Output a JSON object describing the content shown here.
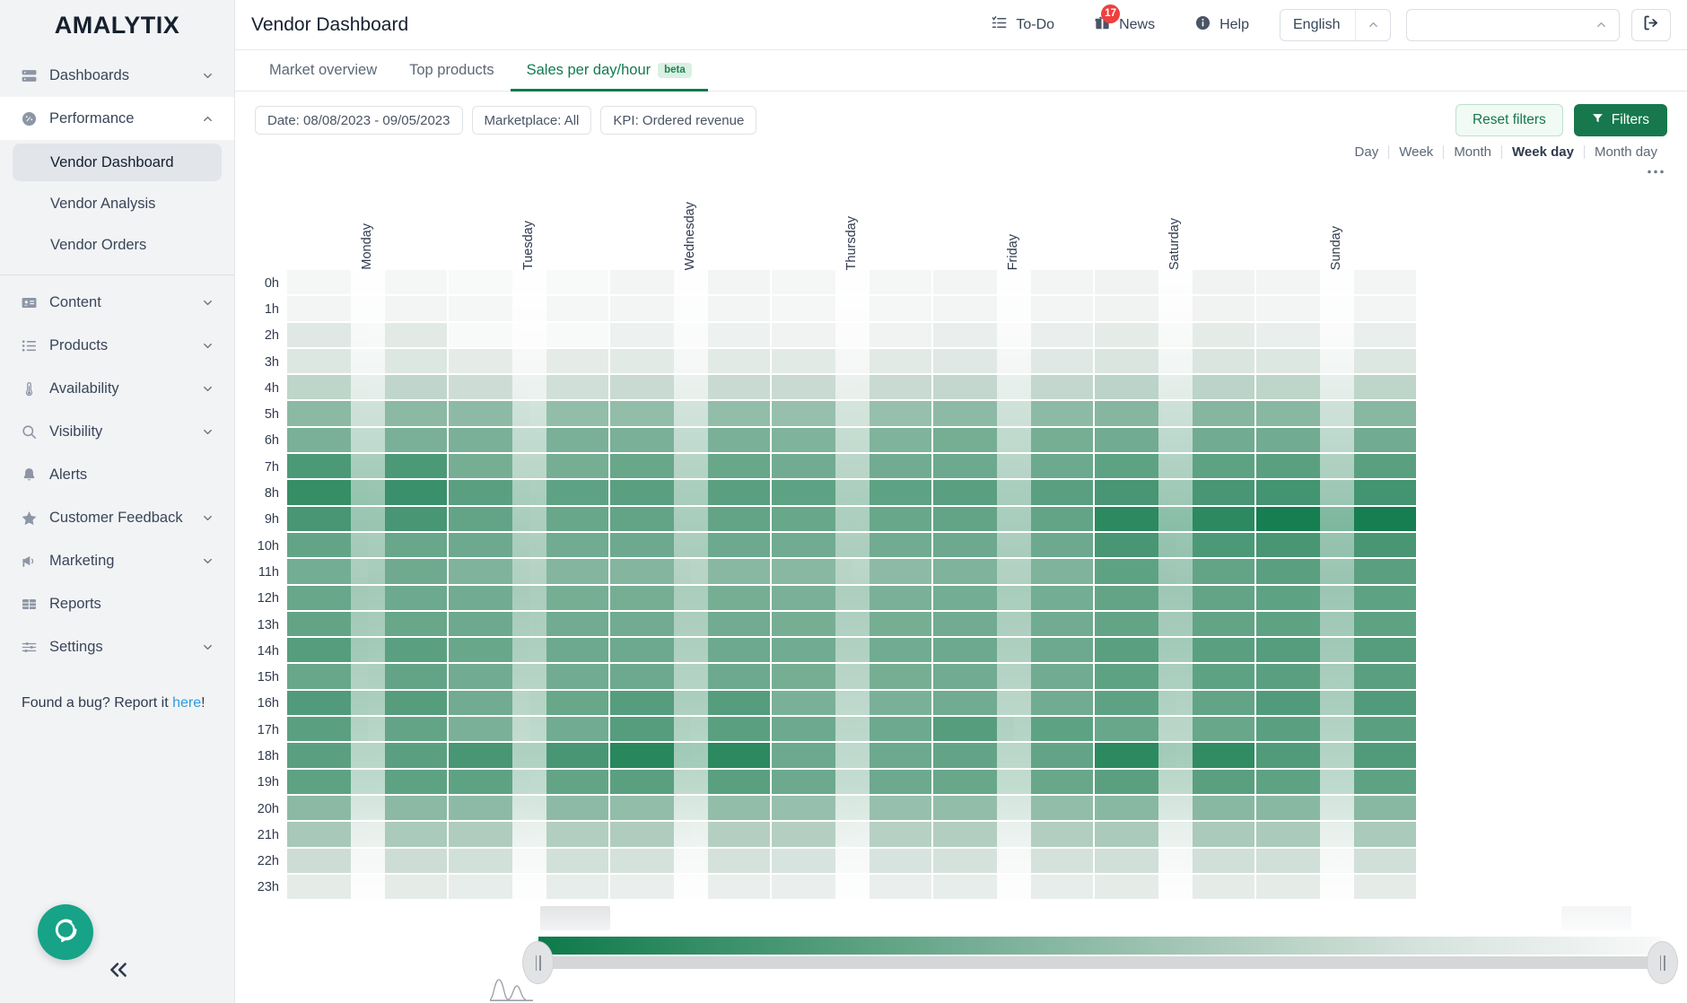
{
  "brand": "AMALYTIX",
  "sidebar": {
    "items": [
      {
        "label": "Dashboards",
        "icon": "dashboards-icon",
        "expandable": true
      },
      {
        "label": "Performance",
        "icon": "performance-icon",
        "expandable": true,
        "expanded": true
      },
      {
        "label": "Content",
        "icon": "content-icon",
        "expandable": true
      },
      {
        "label": "Products",
        "icon": "products-icon",
        "expandable": true
      },
      {
        "label": "Availability",
        "icon": "availability-icon",
        "expandable": true
      },
      {
        "label": "Visibility",
        "icon": "visibility-icon",
        "expandable": true
      },
      {
        "label": "Alerts",
        "icon": "alerts-icon",
        "expandable": false
      },
      {
        "label": "Customer Feedback",
        "icon": "customer-feedback-icon",
        "expandable": true
      },
      {
        "label": "Marketing",
        "icon": "marketing-icon",
        "expandable": true
      },
      {
        "label": "Reports",
        "icon": "reports-icon",
        "expandable": false
      },
      {
        "label": "Settings",
        "icon": "settings-icon",
        "expandable": true
      }
    ],
    "sub_items": [
      {
        "label": "Vendor Dashboard",
        "selected": true
      },
      {
        "label": "Vendor Analysis",
        "selected": false
      },
      {
        "label": "Vendor Orders",
        "selected": false
      }
    ],
    "bug_text_before": "Found a bug? Report it ",
    "bug_link": "here",
    "bug_text_after": "!"
  },
  "header": {
    "title": "Vendor Dashboard",
    "todo_label": "To-Do",
    "news_label": "News",
    "news_badge": "17",
    "help_label": "Help",
    "language_value": "English",
    "account_value": "",
    "account_placeholder": ""
  },
  "tabs": [
    {
      "label": "Market overview",
      "active": false,
      "badge": null
    },
    {
      "label": "Top products",
      "active": false,
      "badge": null
    },
    {
      "label": "Sales per day/hour",
      "active": true,
      "badge": "beta"
    }
  ],
  "filters": {
    "chips": [
      "Date: 08/08/2023 - 09/05/2023",
      "Marketplace: All",
      "KPI: Ordered revenue"
    ],
    "reset_label": "Reset filters",
    "filters_label": "Filters"
  },
  "granularity": {
    "options": [
      "Day",
      "Week",
      "Month",
      "Week day",
      "Month day"
    ],
    "selected": "Week day"
  },
  "chart_data": {
    "type": "heatmap",
    "title": "Sales per day/hour",
    "xlabel": "",
    "ylabel": "",
    "colorscale": {
      "low": "#ffffff",
      "high": "#0d7a4a",
      "name": "white-to-green"
    },
    "value_unit": "Ordered revenue",
    "categories": [
      "Monday",
      "Tuesday",
      "Wednesday",
      "Thursday",
      "Friday",
      "Saturday",
      "Sunday"
    ],
    "subcolumns_per_category": 2,
    "hours": [
      "0h",
      "1h",
      "2h",
      "3h",
      "4h",
      "5h",
      "6h",
      "7h",
      "8h",
      "9h",
      "10h",
      "11h",
      "12h",
      "13h",
      "14h",
      "15h",
      "16h",
      "17h",
      "18h",
      "19h",
      "20h",
      "21h",
      "22h",
      "23h"
    ],
    "intensity_max": 1.0,
    "series": [
      {
        "name": "Monday",
        "values": [
          [
            0.03,
            0.03
          ],
          [
            0.04,
            0.04
          ],
          [
            0.11,
            0.1
          ],
          [
            0.12,
            0.12
          ],
          [
            0.24,
            0.23
          ],
          [
            0.45,
            0.45
          ],
          [
            0.52,
            0.52
          ],
          [
            0.72,
            0.72
          ],
          [
            0.82,
            0.8
          ],
          [
            0.74,
            0.74
          ],
          [
            0.62,
            0.6
          ],
          [
            0.55,
            0.57
          ],
          [
            0.6,
            0.58
          ],
          [
            0.62,
            0.6
          ],
          [
            0.68,
            0.66
          ],
          [
            0.6,
            0.62
          ],
          [
            0.7,
            0.68
          ],
          [
            0.66,
            0.62
          ],
          [
            0.66,
            0.66
          ],
          [
            0.64,
            0.64
          ],
          [
            0.45,
            0.45
          ],
          [
            0.33,
            0.32
          ],
          [
            0.18,
            0.18
          ],
          [
            0.09,
            0.09
          ]
        ]
      },
      {
        "name": "Tuesday",
        "values": [
          [
            0.02,
            0.02
          ],
          [
            0.03,
            0.03
          ],
          [
            0.02,
            0.02
          ],
          [
            0.09,
            0.09
          ],
          [
            0.18,
            0.17
          ],
          [
            0.44,
            0.42
          ],
          [
            0.52,
            0.52
          ],
          [
            0.54,
            0.54
          ],
          [
            0.66,
            0.64
          ],
          [
            0.62,
            0.6
          ],
          [
            0.58,
            0.56
          ],
          [
            0.5,
            0.48
          ],
          [
            0.56,
            0.54
          ],
          [
            0.58,
            0.56
          ],
          [
            0.6,
            0.58
          ],
          [
            0.56,
            0.56
          ],
          [
            0.56,
            0.6
          ],
          [
            0.52,
            0.56
          ],
          [
            0.74,
            0.74
          ],
          [
            0.64,
            0.62
          ],
          [
            0.44,
            0.44
          ],
          [
            0.3,
            0.29
          ],
          [
            0.16,
            0.16
          ],
          [
            0.08,
            0.08
          ]
        ]
      },
      {
        "name": "Wednesday",
        "values": [
          [
            0.04,
            0.04
          ],
          [
            0.04,
            0.04
          ],
          [
            0.06,
            0.06
          ],
          [
            0.1,
            0.1
          ],
          [
            0.2,
            0.2
          ],
          [
            0.42,
            0.42
          ],
          [
            0.52,
            0.52
          ],
          [
            0.6,
            0.6
          ],
          [
            0.66,
            0.66
          ],
          [
            0.62,
            0.62
          ],
          [
            0.58,
            0.58
          ],
          [
            0.48,
            0.46
          ],
          [
            0.54,
            0.54
          ],
          [
            0.56,
            0.56
          ],
          [
            0.58,
            0.58
          ],
          [
            0.58,
            0.58
          ],
          [
            0.68,
            0.68
          ],
          [
            0.68,
            0.66
          ],
          [
            0.88,
            0.86
          ],
          [
            0.66,
            0.66
          ],
          [
            0.42,
            0.42
          ],
          [
            0.3,
            0.28
          ],
          [
            0.15,
            0.15
          ],
          [
            0.07,
            0.07
          ]
        ]
      },
      {
        "name": "Thursday",
        "values": [
          [
            0.03,
            0.03
          ],
          [
            0.03,
            0.03
          ],
          [
            0.05,
            0.05
          ],
          [
            0.1,
            0.1
          ],
          [
            0.2,
            0.2
          ],
          [
            0.4,
            0.4
          ],
          [
            0.5,
            0.5
          ],
          [
            0.56,
            0.56
          ],
          [
            0.64,
            0.64
          ],
          [
            0.6,
            0.6
          ],
          [
            0.56,
            0.56
          ],
          [
            0.46,
            0.44
          ],
          [
            0.52,
            0.52
          ],
          [
            0.54,
            0.54
          ],
          [
            0.56,
            0.56
          ],
          [
            0.54,
            0.54
          ],
          [
            0.52,
            0.52
          ],
          [
            0.58,
            0.58
          ],
          [
            0.58,
            0.58
          ],
          [
            0.58,
            0.58
          ],
          [
            0.4,
            0.4
          ],
          [
            0.28,
            0.27
          ],
          [
            0.14,
            0.14
          ],
          [
            0.07,
            0.07
          ]
        ]
      },
      {
        "name": "Friday",
        "values": [
          [
            0.04,
            0.04
          ],
          [
            0.04,
            0.04
          ],
          [
            0.07,
            0.07
          ],
          [
            0.11,
            0.11
          ],
          [
            0.22,
            0.22
          ],
          [
            0.44,
            0.44
          ],
          [
            0.54,
            0.54
          ],
          [
            0.58,
            0.58
          ],
          [
            0.66,
            0.66
          ],
          [
            0.62,
            0.62
          ],
          [
            0.58,
            0.58
          ],
          [
            0.5,
            0.5
          ],
          [
            0.55,
            0.55
          ],
          [
            0.56,
            0.56
          ],
          [
            0.58,
            0.58
          ],
          [
            0.56,
            0.56
          ],
          [
            0.56,
            0.56
          ],
          [
            0.68,
            0.64
          ],
          [
            0.62,
            0.62
          ],
          [
            0.6,
            0.6
          ],
          [
            0.42,
            0.42
          ],
          [
            0.29,
            0.29
          ],
          [
            0.15,
            0.15
          ],
          [
            0.08,
            0.08
          ]
        ]
      },
      {
        "name": "Saturday",
        "values": [
          [
            0.05,
            0.05
          ],
          [
            0.05,
            0.05
          ],
          [
            0.09,
            0.09
          ],
          [
            0.13,
            0.13
          ],
          [
            0.25,
            0.25
          ],
          [
            0.47,
            0.47
          ],
          [
            0.56,
            0.56
          ],
          [
            0.64,
            0.64
          ],
          [
            0.74,
            0.74
          ],
          [
            0.86,
            0.86
          ],
          [
            0.74,
            0.72
          ],
          [
            0.64,
            0.62
          ],
          [
            0.62,
            0.62
          ],
          [
            0.62,
            0.62
          ],
          [
            0.66,
            0.66
          ],
          [
            0.64,
            0.64
          ],
          [
            0.64,
            0.62
          ],
          [
            0.6,
            0.6
          ],
          [
            0.86,
            0.84
          ],
          [
            0.66,
            0.66
          ],
          [
            0.46,
            0.46
          ],
          [
            0.32,
            0.32
          ],
          [
            0.17,
            0.17
          ],
          [
            0.09,
            0.09
          ]
        ]
      },
      {
        "name": "Sunday",
        "values": [
          [
            0.04,
            0.04
          ],
          [
            0.04,
            0.04
          ],
          [
            0.07,
            0.07
          ],
          [
            0.12,
            0.12
          ],
          [
            0.24,
            0.24
          ],
          [
            0.46,
            0.46
          ],
          [
            0.56,
            0.56
          ],
          [
            0.66,
            0.66
          ],
          [
            0.76,
            0.76
          ],
          [
            0.96,
            0.96
          ],
          [
            0.74,
            0.74
          ],
          [
            0.66,
            0.66
          ],
          [
            0.64,
            0.64
          ],
          [
            0.64,
            0.64
          ],
          [
            0.68,
            0.68
          ],
          [
            0.66,
            0.66
          ],
          [
            0.7,
            0.7
          ],
          [
            0.66,
            0.66
          ],
          [
            0.7,
            0.7
          ],
          [
            0.64,
            0.64
          ],
          [
            0.46,
            0.46
          ],
          [
            0.32,
            0.32
          ],
          [
            0.17,
            0.17
          ],
          [
            0.09,
            0.09
          ]
        ]
      }
    ]
  }
}
